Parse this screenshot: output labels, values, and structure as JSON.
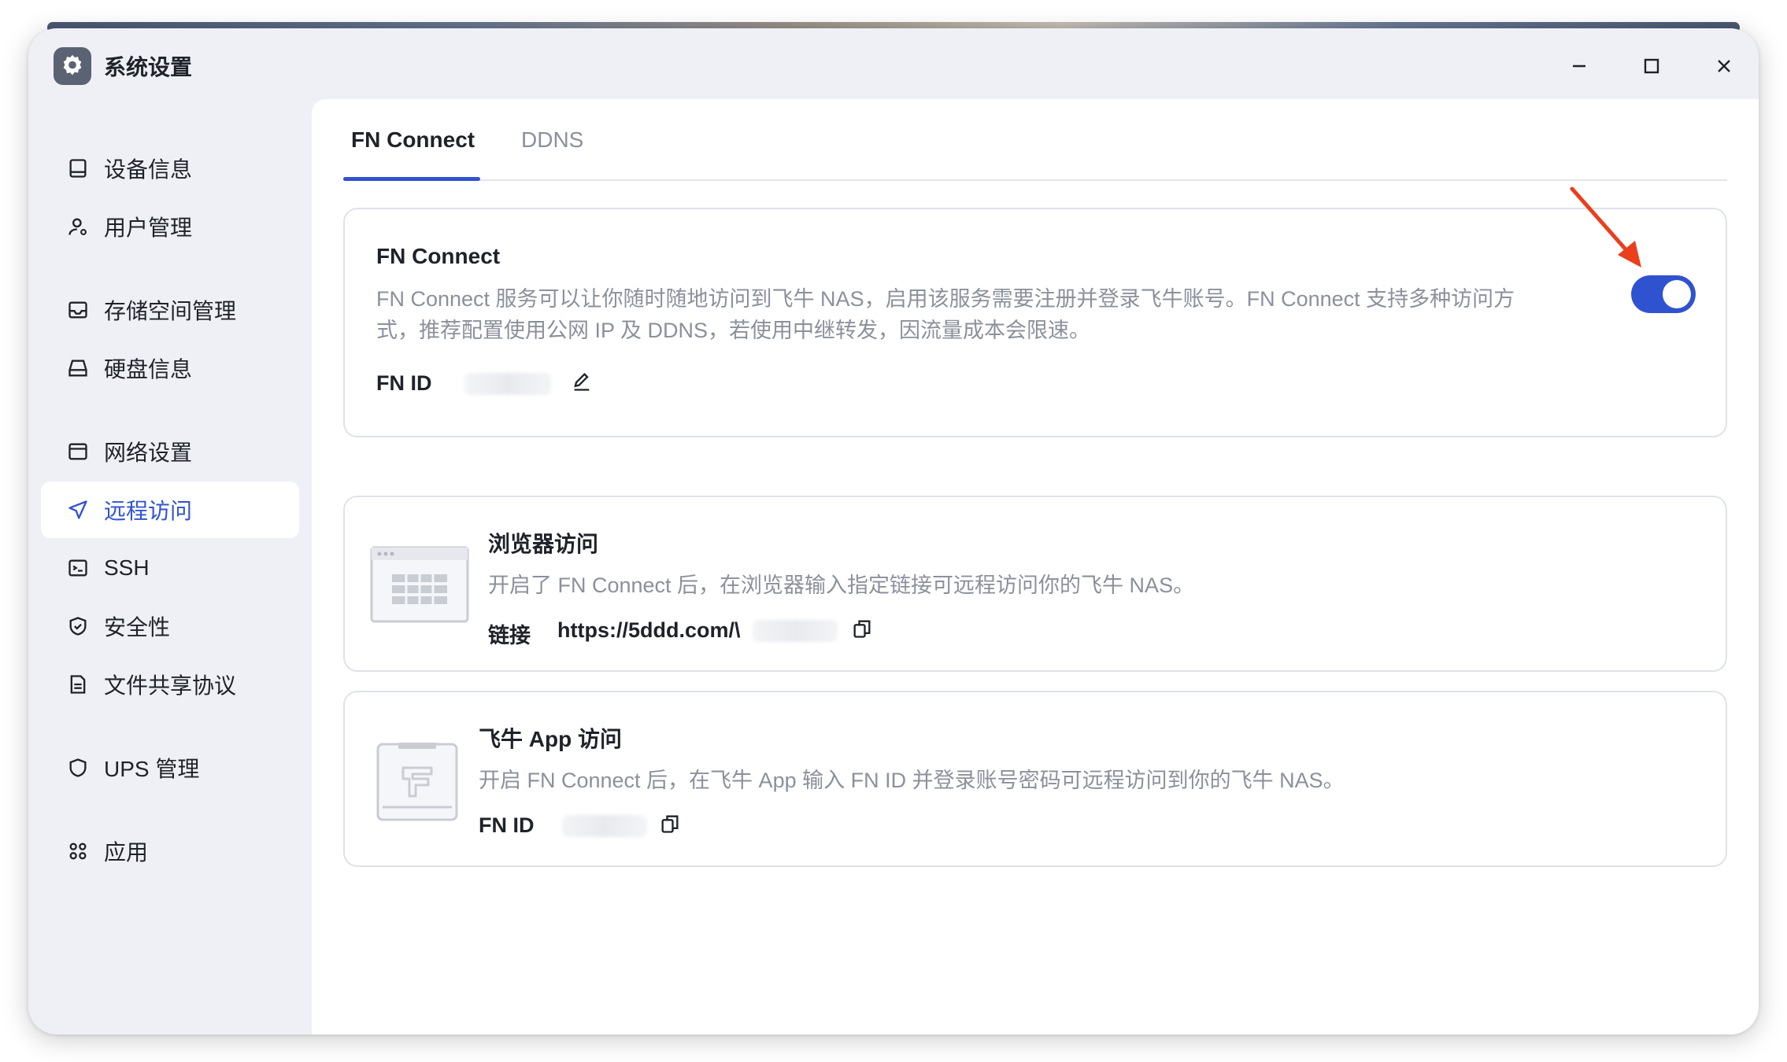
{
  "window": {
    "title": "系统设置",
    "icon": "settings-gear-icon"
  },
  "sidebar": {
    "items": [
      {
        "label": "设备信息",
        "icon": "device-icon"
      },
      {
        "label": "用户管理",
        "icon": "user-icon"
      },
      {
        "label": "存储空间管理",
        "icon": "storage-icon"
      },
      {
        "label": "硬盘信息",
        "icon": "disk-icon"
      },
      {
        "label": "网络设置",
        "icon": "network-icon"
      },
      {
        "label": "远程访问",
        "icon": "send-icon",
        "active": true
      },
      {
        "label": "SSH",
        "icon": "terminal-icon"
      },
      {
        "label": "安全性",
        "icon": "shield-check-icon"
      },
      {
        "label": "文件共享协议",
        "icon": "document-icon"
      },
      {
        "label": "UPS 管理",
        "icon": "shield-icon"
      },
      {
        "label": "应用",
        "icon": "apps-icon"
      }
    ]
  },
  "tabs": [
    {
      "label": "FN Connect",
      "active": true
    },
    {
      "label": "DDNS",
      "active": false
    }
  ],
  "fn_connect_card": {
    "title": "FN Connect",
    "description_line1": "FN Connect 服务可以让你随时随地访问到飞牛 NAS，启用该服务需要注册并登录飞牛账号。FN Connect 支持多种访问方",
    "description_line2": "式，推荐配置使用公网 IP 及 DDNS，若使用中继转发，因流量成本会限速。",
    "fn_id_label": "FN ID",
    "toggle_enabled": true,
    "accent_color": "#2f53d0"
  },
  "browser_card": {
    "title": "浏览器访问",
    "description": "开启了 FN Connect 后，在浏览器输入指定链接可远程访问你的飞牛 NAS。",
    "link_label": "链接",
    "link_value": "https://5ddd.com/\\"
  },
  "app_card": {
    "title": "飞牛 App 访问",
    "description": "开启 FN Connect 后，在飞牛 App 输入 FN ID 并登录账号密码可远程访问到你的飞牛 NAS。",
    "fn_id_label": "FN ID"
  }
}
